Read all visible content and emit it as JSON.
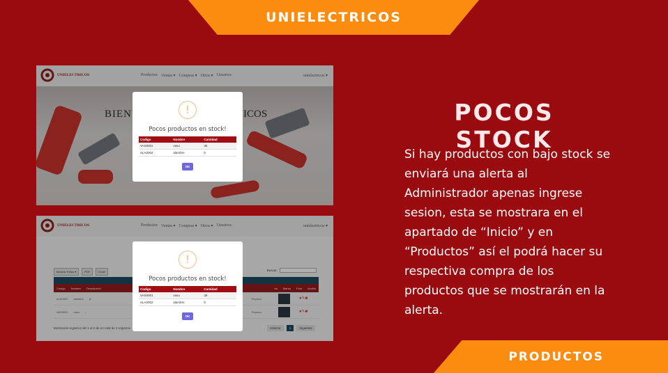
{
  "top_banner": "UNIELECTRICOS",
  "bottom_banner": "PRODUCTOS",
  "title": "POCOS STOCK",
  "description": "Si hay productos con bajo stock se enviará una alerta al Administrador apenas ingrese sesion, esta se mostrara en el apartado de “Inicio” y en “Productos” así el podrá hacer su respectiva compra de los productos que se mostrarán en la alerta.",
  "app": {
    "brand": "UNIELECTRICOS",
    "menu": [
      "Productos",
      "Ventas ▾",
      "Compras ▾",
      "Otros ▾",
      "Usuarios"
    ],
    "user": "unielectricos ▾"
  },
  "home": {
    "welcome_left": "BIENV",
    "welcome_right": "ICOS"
  },
  "modal": {
    "icon": "!",
    "title": "Pocos productos en stock!",
    "headers": [
      "Codigo",
      "Nombre",
      "Cantidad"
    ],
    "rows": [
      [
        "VAS0001",
        "vaso",
        "35"
      ],
      [
        "ALA0002",
        "alambre",
        "0"
      ]
    ],
    "rows_b": [
      [
        "VAS0001",
        "vaso",
        "39"
      ],
      [
        "ALA0002",
        "alambre",
        "0"
      ]
    ],
    "ok": "OK"
  },
  "products": {
    "controls": [
      "Mostrar 5 filas ▾",
      "PDF",
      "Excel"
    ],
    "search_label": "Buscar:",
    "headers": [
      "Codigo",
      "Nombre",
      "Descripción",
      "es",
      "Marca",
      "Foto",
      "Acción"
    ],
    "rows": [
      {
        "code": "ALA0002",
        "name": "alambre",
        "desc": "jk",
        "brand": "Pepsico"
      },
      {
        "code": "VAS0001",
        "name": "vaso",
        "desc": "-",
        "brand": "Pepsico"
      }
    ],
    "footer": "Mostrando registros del 1 al 2 de un total de 2 registros",
    "pager": [
      "Anterior",
      "1",
      "Siguiente"
    ]
  },
  "colors": {
    "background": "#9a0b0f",
    "banner": "#fb8c10",
    "table_header": "#a00e14",
    "ok_button": "#7066e0"
  }
}
